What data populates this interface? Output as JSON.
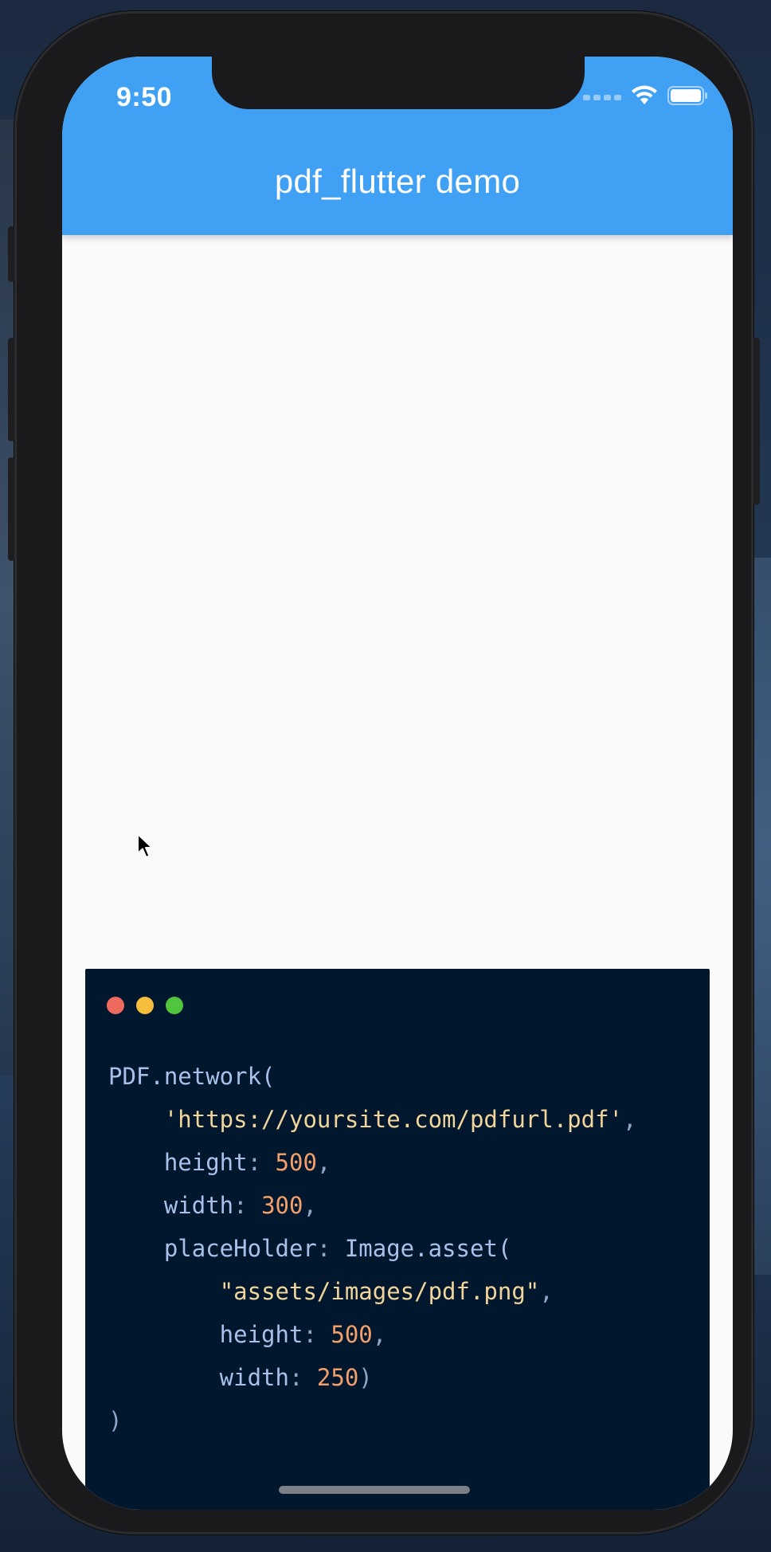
{
  "status_bar": {
    "time": "9:50"
  },
  "app_bar": {
    "title": "pdf_flutter demo",
    "color": "#40a0f4"
  },
  "code_card": {
    "background": "#01172e",
    "window_controls": [
      "close-dot",
      "minimize-dot",
      "maximize-dot"
    ],
    "lines": [
      [
        {
          "t": "PDF.network(",
          "k": "fn"
        }
      ],
      [
        {
          "t": "    ",
          "k": "fn"
        },
        {
          "t": "'https://yoursite.com/pdfurl.pdf'",
          "k": "str"
        },
        {
          "t": ",",
          "k": "punc"
        }
      ],
      [
        {
          "t": "    height",
          "k": "fn"
        },
        {
          "t": ": ",
          "k": "punc"
        },
        {
          "t": "500",
          "k": "num"
        },
        {
          "t": ",",
          "k": "punc"
        }
      ],
      [
        {
          "t": "    width",
          "k": "fn"
        },
        {
          "t": ": ",
          "k": "punc"
        },
        {
          "t": "300",
          "k": "num"
        },
        {
          "t": ",",
          "k": "punc"
        }
      ],
      [
        {
          "t": "    placeHolder",
          "k": "fn"
        },
        {
          "t": ": ",
          "k": "punc"
        },
        {
          "t": "Image.asset(",
          "k": "fn"
        }
      ],
      [
        {
          "t": "        ",
          "k": "fn"
        },
        {
          "t": "\"assets/images/pdf.png\"",
          "k": "str"
        },
        {
          "t": ",",
          "k": "punc"
        }
      ],
      [
        {
          "t": "        height",
          "k": "fn"
        },
        {
          "t": ": ",
          "k": "punc"
        },
        {
          "t": "500",
          "k": "num"
        },
        {
          "t": ",",
          "k": "punc"
        }
      ],
      [
        {
          "t": "        width",
          "k": "fn"
        },
        {
          "t": ": ",
          "k": "punc"
        },
        {
          "t": "250",
          "k": "num"
        },
        {
          "t": ")",
          "k": "punc"
        }
      ],
      [
        {
          "t": ")",
          "k": "punc"
        }
      ]
    ]
  },
  "icons": {
    "wifi": "wifi-icon",
    "battery": "battery-icon",
    "cursor": "mouse-cursor-icon"
  }
}
